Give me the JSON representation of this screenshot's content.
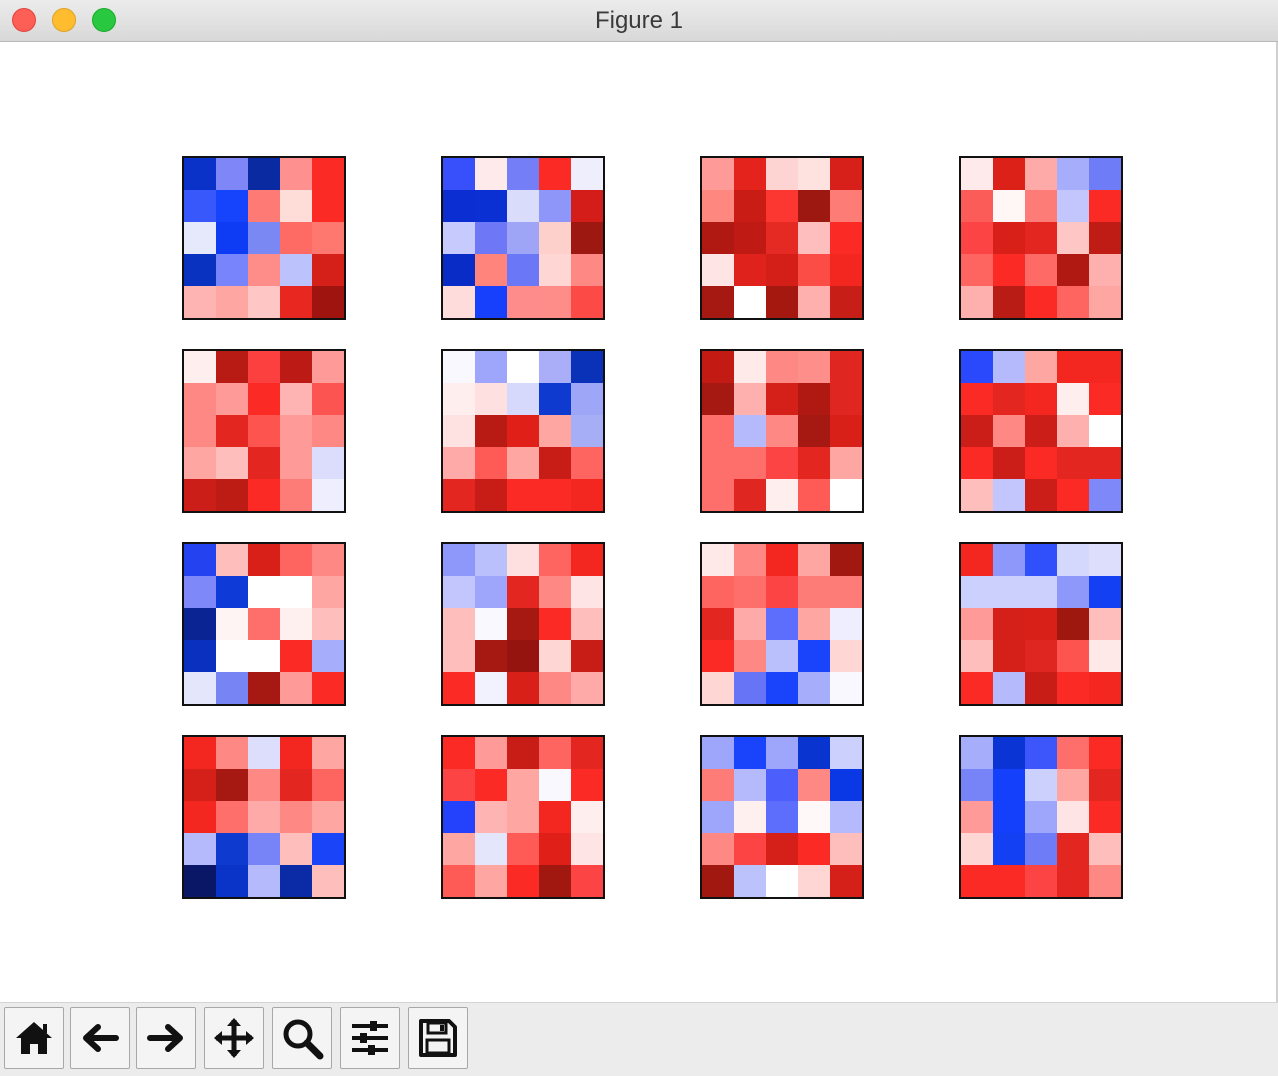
{
  "window": {
    "title": "Figure 1"
  },
  "toolbar": {
    "tools": [
      {
        "icon": "home-icon"
      },
      {
        "icon": "back-arrow-icon"
      },
      {
        "icon": "forward-arrow-icon"
      },
      {
        "icon": "pan-move-icon"
      },
      {
        "icon": "zoom-magnifier-icon"
      },
      {
        "icon": "configure-subplots-icon"
      },
      {
        "icon": "save-floppy-icon"
      }
    ]
  },
  "chart_data": {
    "type": "heatmap",
    "layout": {
      "rows": 4,
      "cols": 4
    },
    "colormap": "bwr",
    "cell_grid": [
      5,
      5
    ],
    "panels": [
      {
        "colors": [
          [
            "#0a32c8",
            "#7e86f8",
            "#0a2aa2",
            "#fe9090",
            "#fc2a24"
          ],
          [
            "#3858fc",
            "#1644fc",
            "#fe7b75",
            "#fedcd8",
            "#fc2a24"
          ],
          [
            "#e6e8fc",
            "#0e3cf4",
            "#7a88f4",
            "#fe6a64",
            "#fe7870"
          ],
          [
            "#0a32c0",
            "#7784fc",
            "#fe8c88",
            "#bcc2fc",
            "#d42018"
          ],
          [
            "#feb4b2",
            "#fea6a2",
            "#fec6c4",
            "#e82820",
            "#a01410"
          ]
        ]
      },
      {
        "colors": [
          [
            "#3850fc",
            "#feeaea",
            "#747ef6",
            "#fc2a24",
            "#eeeefc"
          ],
          [
            "#0a2ed2",
            "#0a30d4",
            "#dadcfc",
            "#8e96fa",
            "#d41c18"
          ],
          [
            "#c6cafc",
            "#6e78f6",
            "#9ea4f6",
            "#fed0cc",
            "#9c1810"
          ],
          [
            "#0a2cc6",
            "#fe847c",
            "#6a78f8",
            "#fed6d4",
            "#fe8884"
          ],
          [
            "#fedcdc",
            "#1640fc",
            "#fe8c8a",
            "#fe8c88",
            "#fc4a46"
          ]
        ]
      },
      {
        "colors": [
          [
            "#fe9a98",
            "#e4241c",
            "#fed4d2",
            "#fee2e0",
            "#d8201a"
          ],
          [
            "#fe8880",
            "#c81c14",
            "#fc3630",
            "#9e1812",
            "#fe7c76"
          ],
          [
            "#b01812",
            "#c01a14",
            "#e42a22",
            "#febebe",
            "#fc2a24"
          ],
          [
            "#fee4e4",
            "#e0221c",
            "#d41e18",
            "#fc4c46",
            "#f42620"
          ],
          [
            "#a61812",
            "#ffffff",
            "#a41810",
            "#feb0ae",
            "#c81e18"
          ]
        ]
      },
      {
        "colors": [
          [
            "#feeaea",
            "#dc2218",
            "#feaaa8",
            "#a6aefc",
            "#6e7cf8"
          ],
          [
            "#fc5c58",
            "#fff6f6",
            "#fe7c78",
            "#c2c6fc",
            "#fc2a24"
          ],
          [
            "#fc4444",
            "#d82018",
            "#e42620",
            "#fec6c4",
            "#c01c16"
          ],
          [
            "#fe6460",
            "#fc2a24",
            "#fe6a66",
            "#b01812",
            "#feb0ae"
          ],
          [
            "#feb0ae",
            "#b81c14",
            "#fc2a24",
            "#fe6460",
            "#fea6a2"
          ]
        ]
      },
      {
        "colors": [
          [
            "#feeeee",
            "#b81a14",
            "#fc4040",
            "#bc1a14",
            "#fe9a98"
          ],
          [
            "#fe8884",
            "#fe9a98",
            "#fc2a24",
            "#feb4b2",
            "#fc5450"
          ],
          [
            "#fe8884",
            "#e42620",
            "#fe5450",
            "#fe9a98",
            "#fe8884"
          ],
          [
            "#fea6a2",
            "#febebc",
            "#e42620",
            "#fe9a98",
            "#dcdcfc"
          ],
          [
            "#cc1e18",
            "#bc1c14",
            "#fc2a24",
            "#fe7c78",
            "#eeeefe"
          ]
        ]
      },
      {
        "colors": [
          [
            "#f8f8fe",
            "#9ea6fc",
            "#ffffff",
            "#aaaef8",
            "#0a32b8"
          ],
          [
            "#feeeee",
            "#fee0e0",
            "#d6d8fc",
            "#0e3ad0",
            "#9ea6f8"
          ],
          [
            "#fee2e2",
            "#b81a14",
            "#e02018",
            "#fea6a2",
            "#a6aef6"
          ],
          [
            "#feaaa8",
            "#fe5a56",
            "#fea6a2",
            "#c81c16",
            "#fe6460"
          ],
          [
            "#e42620",
            "#c81c16",
            "#fc2a24",
            "#fc2a24",
            "#f42620"
          ]
        ]
      },
      {
        "colors": [
          [
            "#c41a14",
            "#feeae8",
            "#fe8884",
            "#fe8e8a",
            "#e02620"
          ],
          [
            "#a61812",
            "#feb0ae",
            "#d42018",
            "#b01812",
            "#e02620"
          ],
          [
            "#fe6e6a",
            "#b4bafc",
            "#fe8884",
            "#a61812",
            "#d82018"
          ],
          [
            "#fe6e6a",
            "#fe6e6a",
            "#fc4444",
            "#e42620",
            "#fea6a2"
          ],
          [
            "#fe6e6a",
            "#e02620",
            "#feeeee",
            "#fe5a56",
            "#ffffff"
          ]
        ]
      },
      {
        "colors": [
          [
            "#2a48fc",
            "#b4bafc",
            "#fea6a2",
            "#f42620",
            "#f42620"
          ],
          [
            "#fc2a24",
            "#e42620",
            "#f42620",
            "#feeeee",
            "#fc2a24"
          ],
          [
            "#cc1e18",
            "#fe8884",
            "#cc1e18",
            "#feb0ae",
            "#ffffff"
          ],
          [
            "#fc2a24",
            "#cc1e18",
            "#fc2a24",
            "#e42620",
            "#e42620"
          ],
          [
            "#febebc",
            "#c2c6fc",
            "#cc1e18",
            "#fc2a24",
            "#7e88f8"
          ]
        ]
      },
      {
        "colors": [
          [
            "#2442f0",
            "#febebc",
            "#d82018",
            "#fe6460",
            "#fe8884"
          ],
          [
            "#7e88f8",
            "#0e3ad8",
            "#ffffff",
            "#ffffff",
            "#fea6a2"
          ],
          [
            "#0a2494",
            "#fff4f4",
            "#fe6e6a",
            "#fff0f0",
            "#febebc"
          ],
          [
            "#0a30c0",
            "#ffffff",
            "#ffffff",
            "#fc2a24",
            "#a6aefc"
          ],
          [
            "#e4e6fc",
            "#7784f4",
            "#a61812",
            "#fe9a98",
            "#fc2a24"
          ]
        ]
      },
      {
        "colors": [
          [
            "#8e98fa",
            "#bac0fc",
            "#fee0e0",
            "#fe6460",
            "#f42620"
          ],
          [
            "#c2c6fc",
            "#9ea6fc",
            "#e42620",
            "#fe8884",
            "#fee4e4"
          ],
          [
            "#febebc",
            "#f8f8fe",
            "#a61812",
            "#fc2a24",
            "#febebc"
          ],
          [
            "#febebc",
            "#a61812",
            "#961410",
            "#fed6d4",
            "#c81c16"
          ],
          [
            "#fc2a24",
            "#f2f2fe",
            "#d82018",
            "#fe8884",
            "#feaaa8"
          ]
        ]
      },
      {
        "colors": [
          [
            "#fee8e8",
            "#fe8884",
            "#f42620",
            "#fea6a2",
            "#a01810"
          ],
          [
            "#fe6460",
            "#fe6e6a",
            "#fc4444",
            "#fe7c78",
            "#fe7c78"
          ],
          [
            "#e42620",
            "#feaaa8",
            "#5e6efc",
            "#fea6a2",
            "#eeeefe"
          ],
          [
            "#fc2a24",
            "#fe8884",
            "#bac0fc",
            "#1a44fc",
            "#fed6d4"
          ],
          [
            "#fed6d4",
            "#6874f6",
            "#1a44fc",
            "#a6aefc",
            "#f8f8fe"
          ]
        ]
      },
      {
        "colors": [
          [
            "#f42620",
            "#8e98fa",
            "#3050fc",
            "#d4d8fc",
            "#dcdefc"
          ],
          [
            "#ccd0fc",
            "#ccd0fc",
            "#ccd0fc",
            "#8e98fa",
            "#1440f4"
          ],
          [
            "#fe9a98",
            "#d42018",
            "#d82018",
            "#9e1810",
            "#febebc"
          ],
          [
            "#febebc",
            "#d42018",
            "#e02620",
            "#fe5450",
            "#fee8e8"
          ],
          [
            "#fc2a24",
            "#b4bafc",
            "#c81c16",
            "#fc2a24",
            "#f42620"
          ]
        ]
      },
      {
        "colors": [
          [
            "#f42620",
            "#fe8884",
            "#dcdefc",
            "#f42620",
            "#fea6a2"
          ],
          [
            "#d42018",
            "#a61812",
            "#fe8884",
            "#e42620",
            "#fe6460"
          ],
          [
            "#f42620",
            "#fe6e6a",
            "#feaaa8",
            "#fe8884",
            "#fea6a2"
          ],
          [
            "#b4bafc",
            "#0e3ad0",
            "#7784f8",
            "#febebc",
            "#1a44f8"
          ],
          [
            "#0a1666",
            "#0a34c8",
            "#b4bafc",
            "#0a2aa6",
            "#febebc"
          ]
        ]
      },
      {
        "colors": [
          [
            "#fc2a24",
            "#fe9a98",
            "#c81c16",
            "#fe6460",
            "#e42620"
          ],
          [
            "#fc4444",
            "#fc2a24",
            "#fea6a2",
            "#f8f8fe",
            "#fc2a24"
          ],
          [
            "#2442fc",
            "#feb4b2",
            "#fea6a2",
            "#f42620",
            "#feeeee"
          ],
          [
            "#fea6a2",
            "#e4e6fc",
            "#fe5a56",
            "#e02018",
            "#fee4e4"
          ],
          [
            "#fe5a56",
            "#fea6a2",
            "#fc2a24",
            "#a01810",
            "#fc4444"
          ]
        ]
      },
      {
        "colors": [
          [
            "#9ea6fc",
            "#1a44fc",
            "#9ea6fc",
            "#0a34d0",
            "#ccd0fc"
          ],
          [
            "#fe7c78",
            "#b4bafc",
            "#4c5efc",
            "#fe8884",
            "#0a38e4"
          ],
          [
            "#9ea6fc",
            "#fff0f0",
            "#5e6efc",
            "#fff8f8",
            "#b4bafc"
          ],
          [
            "#fe8884",
            "#fc4444",
            "#d42018",
            "#fc2a24",
            "#febebc"
          ],
          [
            "#a01810",
            "#bcc2fc",
            "#ffffff",
            "#fed6d4",
            "#d42018"
          ]
        ]
      },
      {
        "colors": [
          [
            "#a6aefc",
            "#0a34d4",
            "#3c56fc",
            "#fe6e6a",
            "#fc2a24"
          ],
          [
            "#7784f8",
            "#1440fc",
            "#ccd0fc",
            "#fea6a2",
            "#e42620"
          ],
          [
            "#fe9a98",
            "#1440fc",
            "#9ea6fc",
            "#fee4e4",
            "#fc2a24"
          ],
          [
            "#fed6d4",
            "#1440f4",
            "#6e7cf8",
            "#e42620",
            "#febebc"
          ],
          [
            "#fc2a24",
            "#fc2a24",
            "#fc4444",
            "#e42620",
            "#fe8884"
          ]
        ]
      }
    ]
  }
}
